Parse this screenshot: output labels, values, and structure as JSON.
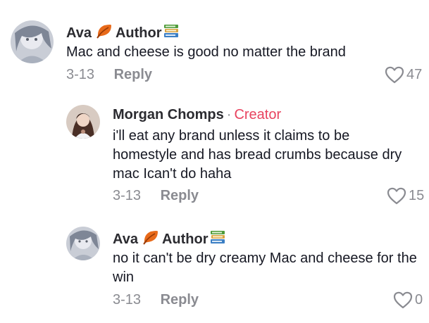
{
  "comments": [
    {
      "username": "Ava",
      "badge": "Author",
      "creator_tag": "",
      "text": "Mac and cheese is good no matter the brand",
      "date": "3-13",
      "reply_label": "Reply",
      "likes": "47"
    },
    {
      "username": "Morgan Chomps",
      "badge": "",
      "creator_tag": "Creator",
      "text": "i'll eat any brand unless it claims to be homestyle and has bread crumbs because dry mac Ican't do haha",
      "date": "3-13",
      "reply_label": "Reply",
      "likes": "15"
    },
    {
      "username": "Ava",
      "badge": "Author",
      "creator_tag": "",
      "text": "no it can't be dry creamy Mac and cheese for the win",
      "date": "3-13",
      "reply_label": "Reply",
      "likes": "0"
    }
  ],
  "separator": "·",
  "icons": {
    "leaf": "leaf-emoji-icon",
    "books": "books-emoji-icon",
    "like": "heart-outline-icon"
  },
  "colors": {
    "creator": "#e8435f",
    "muted": "#8a8b91",
    "text": "#161823"
  }
}
